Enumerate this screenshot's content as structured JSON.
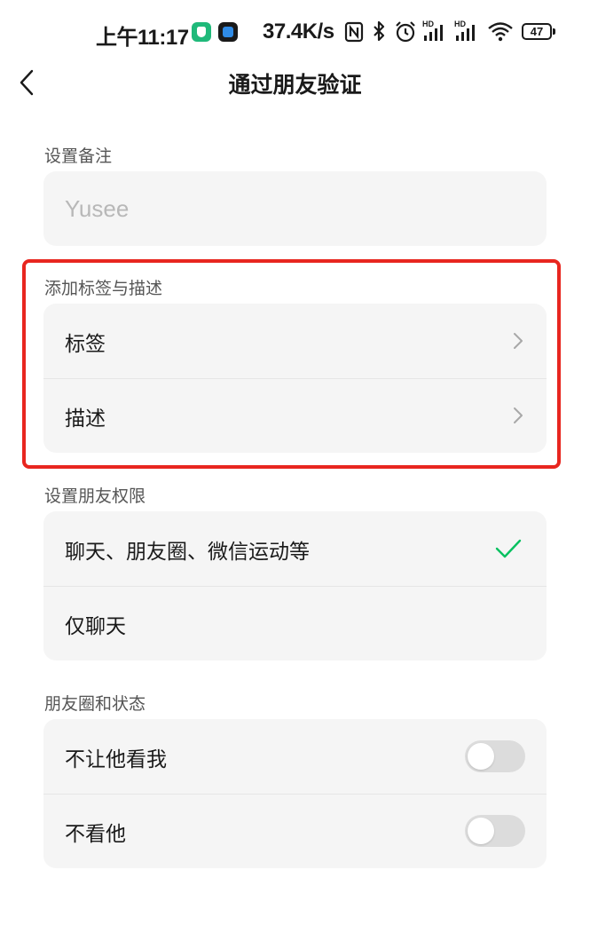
{
  "status_bar": {
    "time": "上午11:17",
    "network_speed": "37.4K/s",
    "battery": "47",
    "icons": [
      "security-app-icon",
      "app-icon",
      "nfc-icon",
      "bluetooth-icon",
      "alarm-icon",
      "hd-signal-icon",
      "hd-signal-icon",
      "wifi-icon",
      "battery-icon"
    ]
  },
  "header": {
    "title": "通过朋友验证",
    "back_icon": "chevron-left-icon"
  },
  "remark": {
    "section_label": "设置备注",
    "placeholder": "Yusee",
    "value": ""
  },
  "tags_section": {
    "section_label": "添加标签与描述",
    "items": [
      {
        "label": "标签",
        "icon": "chevron-right-icon"
      },
      {
        "label": "描述",
        "icon": "chevron-right-icon"
      }
    ]
  },
  "permission_section": {
    "section_label": "设置朋友权限",
    "options": [
      {
        "label": "聊天、朋友圈、微信运动等",
        "selected": true
      },
      {
        "label": "仅聊天",
        "selected": false
      }
    ]
  },
  "moments_section": {
    "section_label": "朋友圈和状态",
    "toggles": [
      {
        "label": "不让他看我",
        "on": false
      },
      {
        "label": "不看他",
        "on": false
      }
    ]
  },
  "colors": {
    "accent_check": "#07c160",
    "highlight_border": "#e8261f",
    "card_bg": "#f5f5f5",
    "toggle_off": "#dcdcdc"
  }
}
